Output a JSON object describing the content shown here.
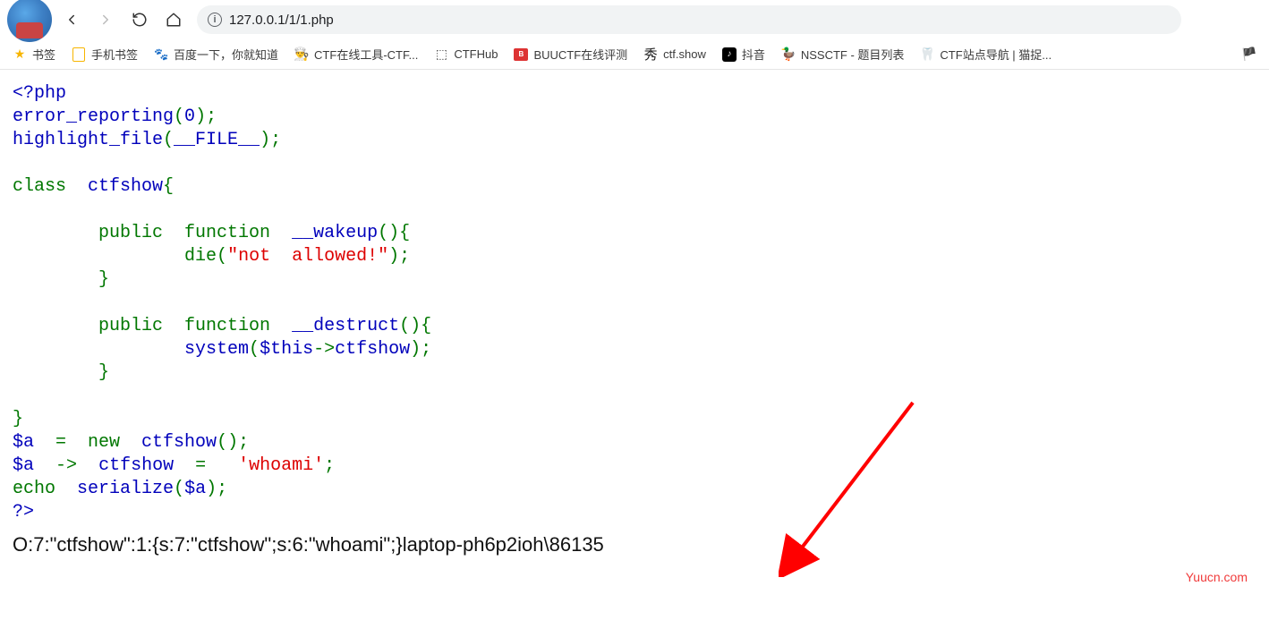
{
  "browser": {
    "url": "127.0.0.1/1/1.php"
  },
  "bookmarks": [
    {
      "label": "书签"
    },
    {
      "label": "手机书签"
    },
    {
      "label": "百度一下，你就知道"
    },
    {
      "label": "CTF在线工具-CTF..."
    },
    {
      "label": "CTFHub"
    },
    {
      "label": "BUUCTF在线评测"
    },
    {
      "label": "ctf.show"
    },
    {
      "label": "抖音"
    },
    {
      "label": "NSSCTF - 题目列表"
    },
    {
      "label": "CTF站点导航 | 猫捉..."
    }
  ],
  "code": {
    "t_php_open": "<?php",
    "t_error_reporting": "error_reporting",
    "t_zero": "0",
    "t_highlight_file": "highlight_file",
    "t_file_const": "__FILE__",
    "t_class": "class ",
    "t_ctfshow": " ctfshow",
    "t_public_function": "public ",
    "t_function": " function ",
    "t_wakeup": " __wakeup",
    "t_die": "die",
    "t_not_allowed": "\"not  allowed!\"",
    "t_destruct": " __destruct",
    "t_system": "system",
    "t_this": "$this",
    "t_arrow": "->",
    "t_ctfshow_prop": "ctfshow",
    "t_a": "$a",
    "t_new": "new ",
    "t_whoami": "'whoami'",
    "t_echo": "echo ",
    "t_serialize": " serialize",
    "t_close": "?>",
    "p_open": "(",
    "p_close": ")",
    "p_open_brace": "{",
    "p_close_brace": "}",
    "p_semi": ";",
    "p_eq": "  =  ",
    "p_assign": "  = "
  },
  "output": "O:7:\"ctfshow\":1:{s:7:\"ctfshow\";s:6:\"whoami\";}laptop-ph6p2ioh\\86135",
  "watermark": "Yuucn.com"
}
